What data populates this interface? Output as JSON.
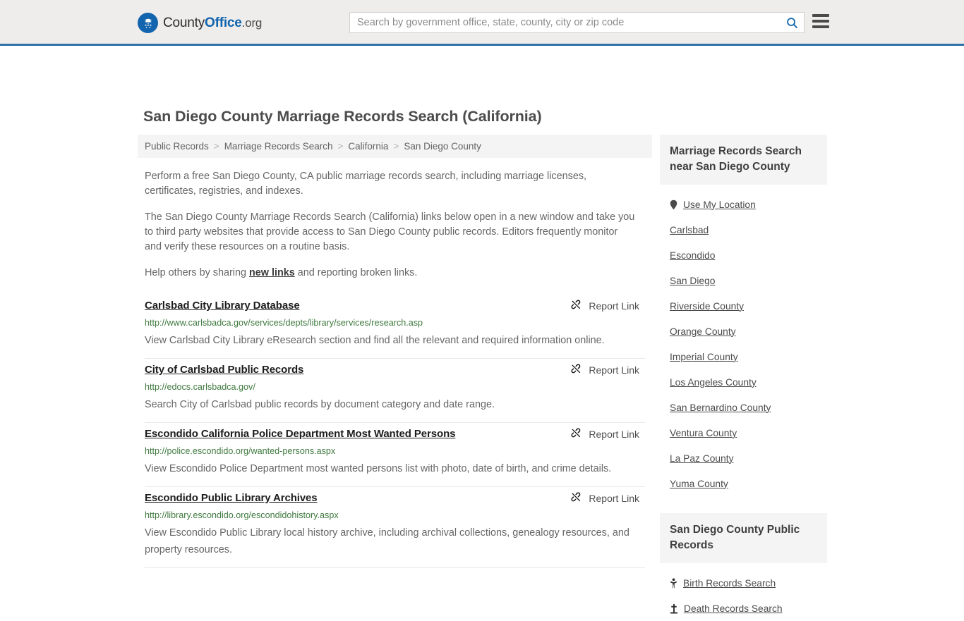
{
  "header": {
    "logo": {
      "icon": "eagle-seal-icon",
      "part1": "County",
      "part2": "Office",
      "part3": ".org"
    },
    "search": {
      "placeholder": "Search by government office, state, county, city or zip code",
      "value": "",
      "search_icon": "search-icon"
    },
    "menu_icon": "hamburger-menu-icon",
    "accent_color": "#2f72a8",
    "background_color": "#eeedec"
  },
  "page_title": "San Diego County Marriage Records Search (California)",
  "breadcrumb": {
    "separator": ">",
    "items": [
      {
        "label": "Public Records"
      },
      {
        "label": "Marriage Records Search"
      },
      {
        "label": "California"
      },
      {
        "label": "San Diego County"
      }
    ]
  },
  "intro": {
    "paragraph_1": "Perform a free San Diego County, CA public marriage records search, including marriage licenses, certificates, registries, and indexes.",
    "paragraph_2": "The San Diego County Marriage Records Search (California) links below open in a new window and take you to third party websites that provide access to San Diego County public records. Editors frequently monitor and verify these resources on a routine basis.",
    "paragraph_3_before": "Help others by sharing ",
    "paragraph_3_link": "new links",
    "paragraph_3_after": " and reporting broken links."
  },
  "report_link": {
    "label": "Report Link",
    "icon": "broken-link-icon"
  },
  "results": [
    {
      "title": "Carlsbad City Library Database",
      "url": "http://www.carlsbadca.gov/services/depts/library/services/research.asp",
      "description": "View Carlsbad City Library eResearch section and find all the relevant and required information online."
    },
    {
      "title": "City of Carlsbad Public Records",
      "url": "http://edocs.carlsbadca.gov/",
      "description": "Search City of Carlsbad public records by document category and date range."
    },
    {
      "title": "Escondido California Police Department Most Wanted Persons",
      "url": "http://police.escondido.org/wanted-persons.aspx",
      "description": "View Escondido Police Department most wanted persons list with photo, date of birth, and crime details."
    },
    {
      "title": "Escondido Public Library Archives",
      "url": "http://library.escondido.org/escondidohistory.aspx",
      "description": "View Escondido Public Library local history archive, including archival collections, genealogy resources, and property resources."
    }
  ],
  "sidebar": {
    "nearby": {
      "heading": "Marriage Records Search near San Diego County",
      "items": [
        {
          "label": "Use My Location",
          "icon": "map-pin-icon"
        },
        {
          "label": "Carlsbad",
          "icon": ""
        },
        {
          "label": "Escondido",
          "icon": ""
        },
        {
          "label": "San Diego",
          "icon": ""
        },
        {
          "label": "Riverside County",
          "icon": ""
        },
        {
          "label": "Orange County",
          "icon": ""
        },
        {
          "label": "Imperial County",
          "icon": ""
        },
        {
          "label": "Los Angeles County",
          "icon": ""
        },
        {
          "label": "San Bernardino County",
          "icon": ""
        },
        {
          "label": "Ventura County",
          "icon": ""
        },
        {
          "label": "La Paz County",
          "icon": ""
        },
        {
          "label": "Yuma County",
          "icon": ""
        }
      ]
    },
    "public_records": {
      "heading": "San Diego County Public Records",
      "items": [
        {
          "label": "Birth Records Search",
          "icon": "baby-icon"
        },
        {
          "label": "Death Records Search",
          "icon": "grave-cross-icon"
        }
      ]
    }
  }
}
